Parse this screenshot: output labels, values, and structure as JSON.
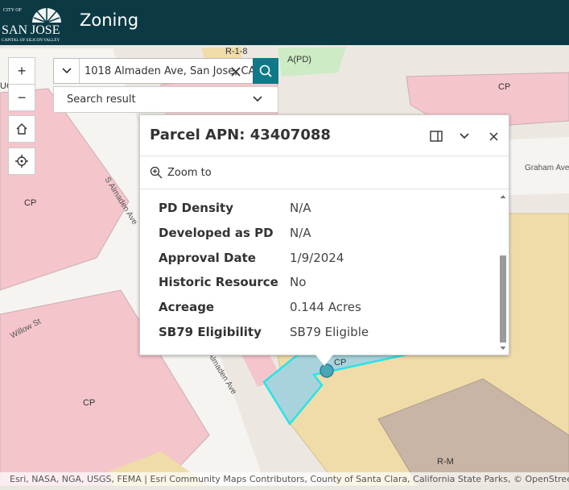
{
  "header": {
    "title": "Zoning",
    "logo": {
      "line1": "CITY OF",
      "line2": "SAN JOSE",
      "line3": "CAPITAL OF SILICON VALLEY"
    }
  },
  "map": {
    "zone_labels": [
      "R-1-8",
      "A(PD)",
      "CP",
      "CP",
      "CP",
      "CP",
      "CP",
      "R-M",
      "R-M",
      "UG"
    ],
    "street_labels": [
      "S Almaden Ave",
      "Graham Ave",
      "Willow St",
      "Almaden Ave"
    ],
    "colors": {
      "commercial": "#f5c5cc",
      "residential": "#efdca8",
      "public": "#c8b5a5",
      "road": "#ffffff",
      "green": "#cdebc4",
      "selected_fill": "#a9d3dc",
      "selected_outline": "#29e3e8"
    },
    "attribution": "Esri, NASA, NGA, USGS, FEMA | Esri Community Maps Contributors, County of Santa Clara, California State Parks, © OpenStreetMap"
  },
  "controls": {
    "zoom_in": "+",
    "zoom_out": "−",
    "home_icon": "home-icon",
    "locate_icon": "locate-icon"
  },
  "search": {
    "value": "1018 Almaden Ave, San Jose, CA",
    "result_label": "Search result"
  },
  "popup": {
    "title": "Parcel APN: 43407088",
    "zoom_to": "Zoom to",
    "attributes": [
      {
        "key": "PD Density",
        "value": "N/A"
      },
      {
        "key": "Developed as PD",
        "value": "N/A"
      },
      {
        "key": "Approval Date",
        "value": "1/9/2024"
      },
      {
        "key": "Historic Resource",
        "value": "No"
      },
      {
        "key": "Acreage",
        "value": "0.144 Acres"
      },
      {
        "key": "SB79 Eligibility",
        "value": "SB79 Eligible"
      }
    ]
  }
}
